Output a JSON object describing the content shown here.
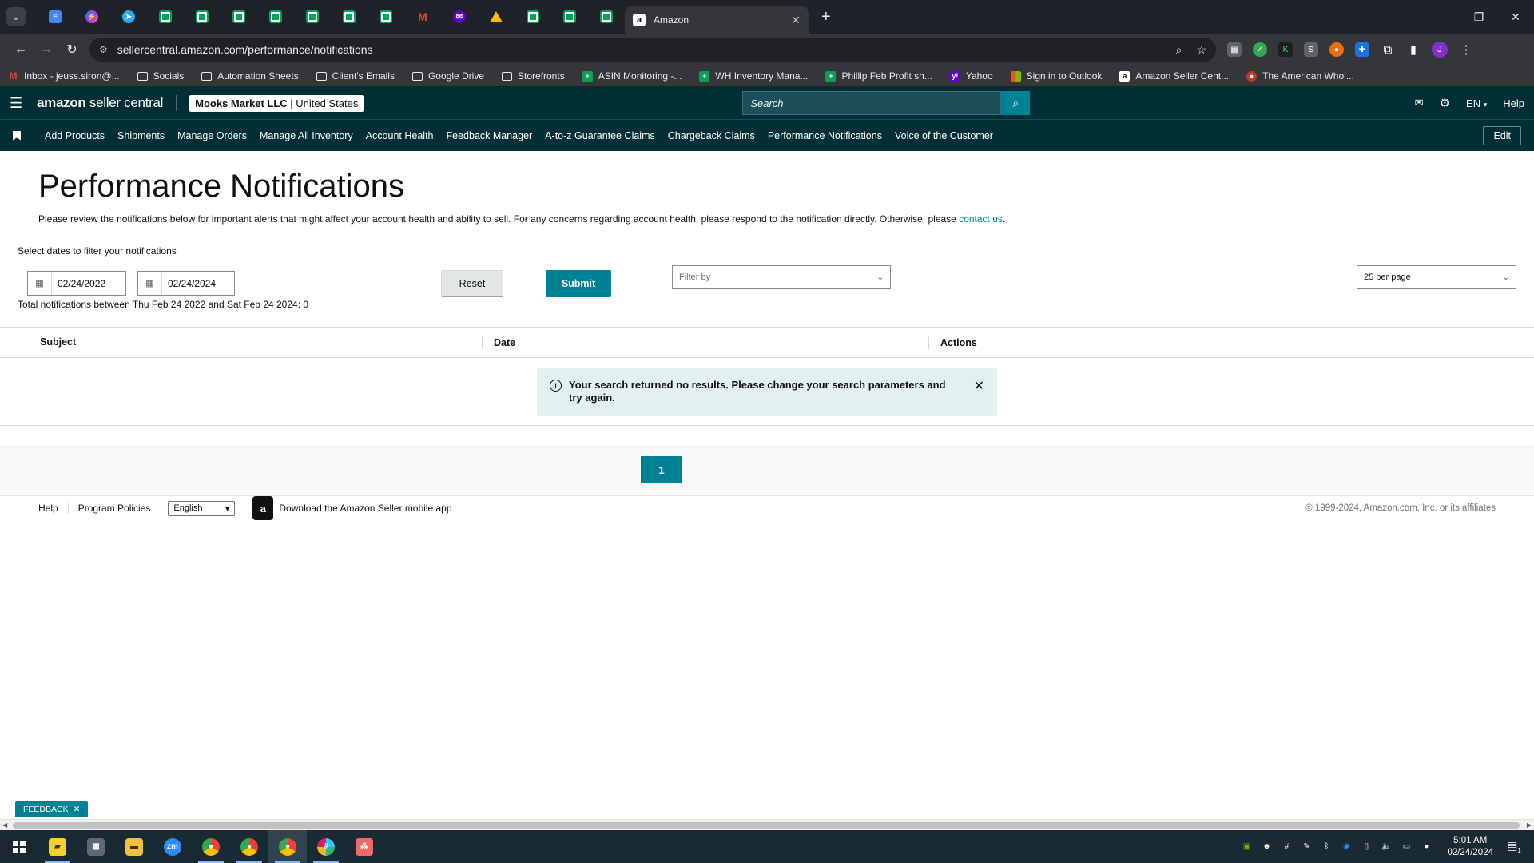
{
  "browser": {
    "active_tab": {
      "title": "Amazon",
      "favicon": "a"
    },
    "url": "sellercentral.amazon.com/performance/notifications",
    "profile_initial": "J",
    "bookmarks": [
      {
        "label": "Inbox - jeuss.siron@...",
        "icon": "gmail-icon"
      },
      {
        "label": "Socials",
        "icon": "folder-icon"
      },
      {
        "label": "Automation Sheets",
        "icon": "folder-icon"
      },
      {
        "label": "Client's Emails",
        "icon": "folder-icon"
      },
      {
        "label": "Google Drive",
        "icon": "folder-icon"
      },
      {
        "label": "Storefronts",
        "icon": "folder-icon"
      },
      {
        "label": "ASIN Monitoring -...",
        "icon": "sheets-icon"
      },
      {
        "label": "WH Inventory Mana...",
        "icon": "sheets-icon"
      },
      {
        "label": "Phillip Feb Profit sh...",
        "icon": "sheets-icon"
      },
      {
        "label": "Yahoo",
        "icon": "yahoo-icon"
      },
      {
        "label": "Sign in to Outlook",
        "icon": "microsoft-icon"
      },
      {
        "label": "Amazon Seller Cent...",
        "icon": "amazon-icon"
      },
      {
        "label": "The American Whol...",
        "icon": "website-icon"
      }
    ]
  },
  "header": {
    "logo_bold": "amazon",
    "logo_thin": " seller central",
    "account_name": "Mooks Market LLC",
    "account_region": " | United States",
    "search_placeholder": "Search",
    "language": "EN",
    "help": "Help"
  },
  "nav": {
    "links": [
      "Add Products",
      "Shipments",
      "Manage Orders",
      "Manage All Inventory",
      "Account Health",
      "Feedback Manager",
      "A-to-z Guarantee Claims",
      "Chargeback Claims",
      "Performance Notifications",
      "Voice of the Customer"
    ],
    "edit": "Edit"
  },
  "page": {
    "title": "Performance Notifications",
    "intro": "Please review the notifications below for important alerts that might affect your account health and ability to sell. For any concerns regarding account health, please respond to the notification directly. Otherwise, please ",
    "intro_link": "contact us",
    "intro_end": ".",
    "filter_label": "Select dates to filter your notifications",
    "start_date": "02/24/2022",
    "end_date": "02/24/2024",
    "total_text": "Total notifications between Thu Feb 24 2022 and Sat Feb 24 2024: 0",
    "reset": "Reset",
    "submit": "Submit",
    "filter_by": "Filter by",
    "per_page": "25 per page"
  },
  "table": {
    "columns": [
      "Subject",
      "Date",
      "Actions"
    ],
    "empty_message": "Your search returned no results. Please change your search parameters and try again."
  },
  "pagination": {
    "current_page": "1"
  },
  "footer": {
    "help": "Help",
    "policies": "Program Policies",
    "language": "English",
    "app_text": "Download the Amazon Seller mobile app",
    "copyright": "© 1999-2024, Amazon.com, Inc. or its affiliates"
  },
  "feedback": "FEEDBACK",
  "taskbar": {
    "time": "5:01 AM",
    "date": "02/24/2024",
    "notification_count": "1"
  },
  "colors": {
    "header_bg": "#002f36",
    "accent": "#008296",
    "alert_bg": "#e3f0f2"
  }
}
